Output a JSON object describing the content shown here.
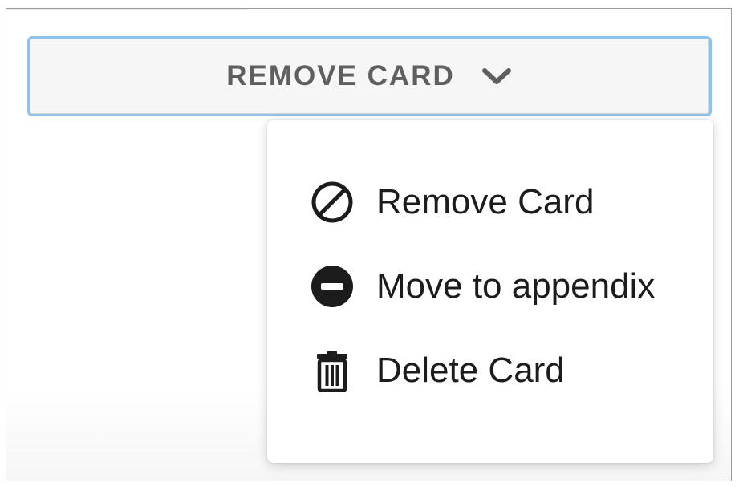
{
  "dropdown": {
    "label": "REMOVE CARD",
    "icon": "chevron-down-icon",
    "focus_border_color": "#8fc3ec"
  },
  "menu": {
    "items": [
      {
        "label": "Remove Card",
        "icon": "prohibited-icon"
      },
      {
        "label": "Move to appendix",
        "icon": "minus-circle-icon"
      },
      {
        "label": "Delete Card",
        "icon": "trash-icon"
      }
    ]
  }
}
